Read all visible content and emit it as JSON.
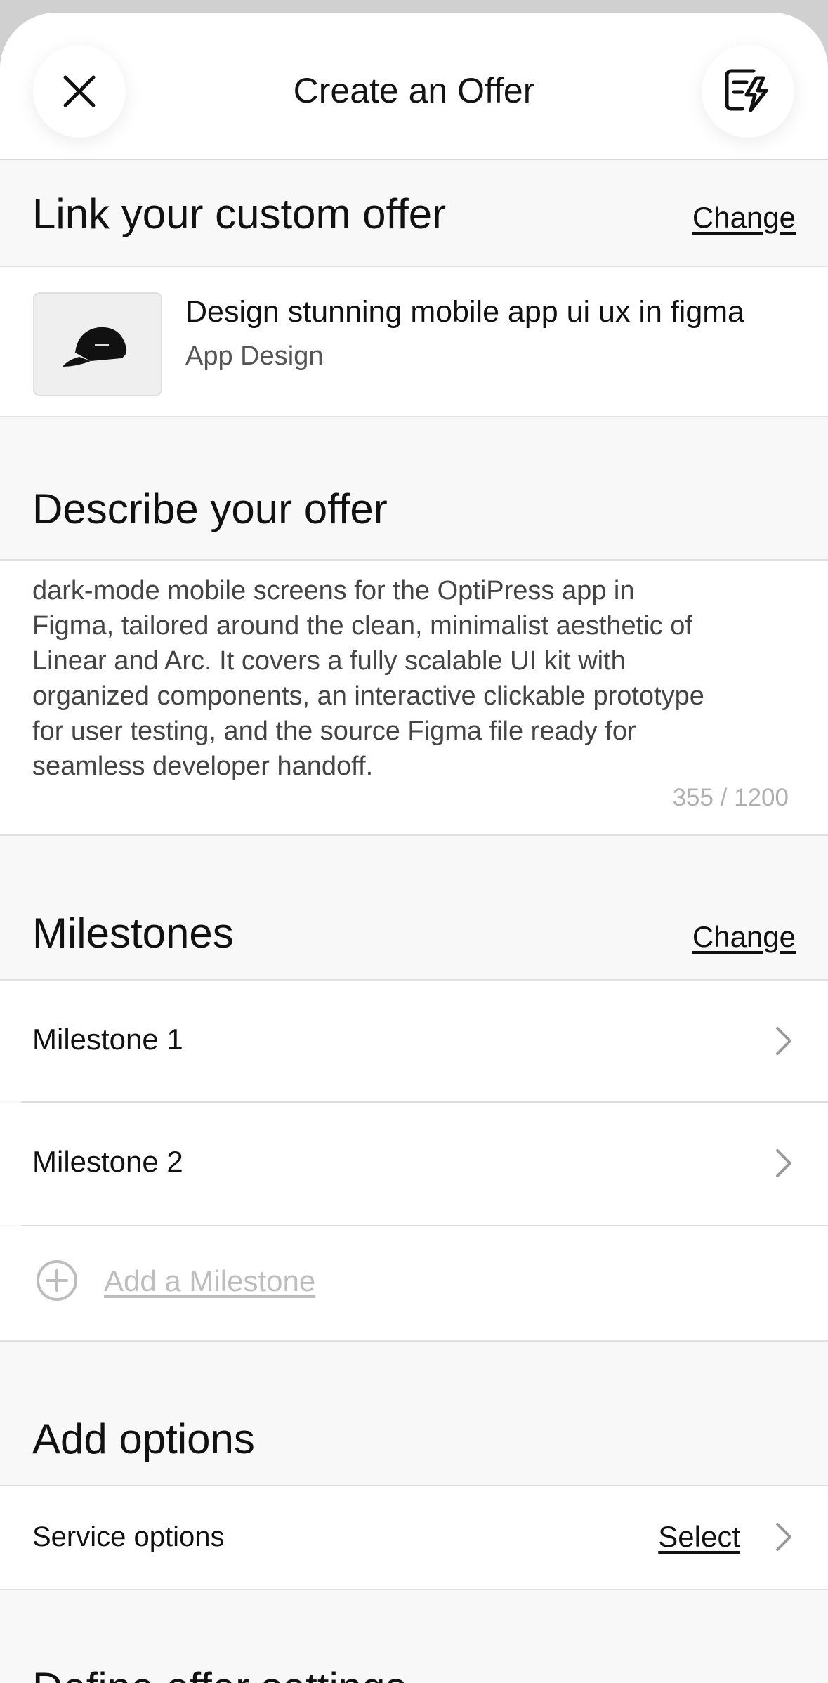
{
  "header": {
    "title": "Create an Offer",
    "close_icon": "close-icon",
    "quick_icon": "quick-offer-icon"
  },
  "link_offer": {
    "heading": "Link your custom offer",
    "change_label": "Change",
    "offer_title": "Design stunning mobile app ui ux in figma",
    "offer_category": "App Design"
  },
  "describe": {
    "heading": "Describe your offer",
    "text_lines": [
      "dark-mode mobile screens for the OptiPress app in",
      "Figma, tailored around the clean, minimalist aesthetic of",
      "Linear and Arc. It covers a fully scalable UI kit with",
      "organized components, an interactive clickable prototype",
      "for user testing, and the source Figma file ready for",
      "seamless developer handoff."
    ],
    "counter": "355 / 1200"
  },
  "milestones": {
    "heading": "Milestones",
    "change_label": "Change",
    "items": [
      "Milestone 1",
      "Milestone 2"
    ],
    "add_label": "Add a Milestone"
  },
  "options": {
    "heading": "Add options",
    "service_label": "Service options",
    "select_label": "Select"
  },
  "settings": {
    "heading": "Define offer settings"
  }
}
